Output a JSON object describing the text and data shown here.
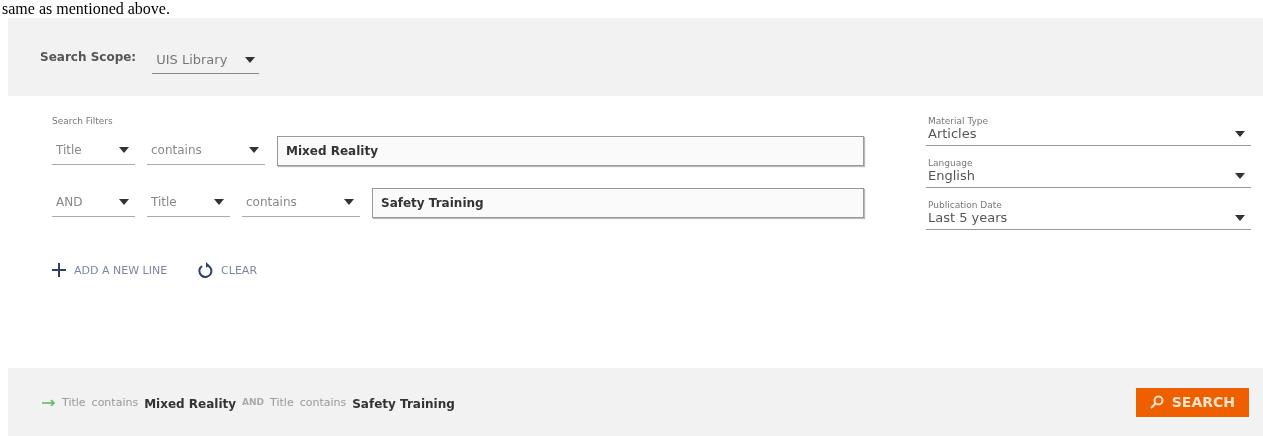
{
  "caption": "same as mentioned above.",
  "search_scope": {
    "label": "Search Scope:",
    "value": "UIS Library"
  },
  "search_filters": {
    "label": "Search Filters",
    "rows": [
      {
        "field": "Title",
        "operator": "contains",
        "value": "Mixed Reality"
      },
      {
        "boolean": "AND",
        "field": "Title",
        "operator": "contains",
        "value": "Safety Training"
      }
    ]
  },
  "facets": [
    {
      "label": "Material Type",
      "value": "Articles"
    },
    {
      "label": "Language",
      "value": "English"
    },
    {
      "label": "Publication Date",
      "value": "Last 5 years"
    }
  ],
  "actions": {
    "add_line": "ADD A NEW LINE",
    "clear": "CLEAR"
  },
  "query_summary": [
    {
      "kind": "field",
      "text": "Title"
    },
    {
      "kind": "operator",
      "text": "contains"
    },
    {
      "kind": "term",
      "text": "Mixed Reality"
    },
    {
      "kind": "boolean",
      "text": "AND"
    },
    {
      "kind": "field",
      "text": "Title"
    },
    {
      "kind": "operator",
      "text": "contains"
    },
    {
      "kind": "term",
      "text": "Safety Training"
    }
  ],
  "search_button": "SEARCH"
}
